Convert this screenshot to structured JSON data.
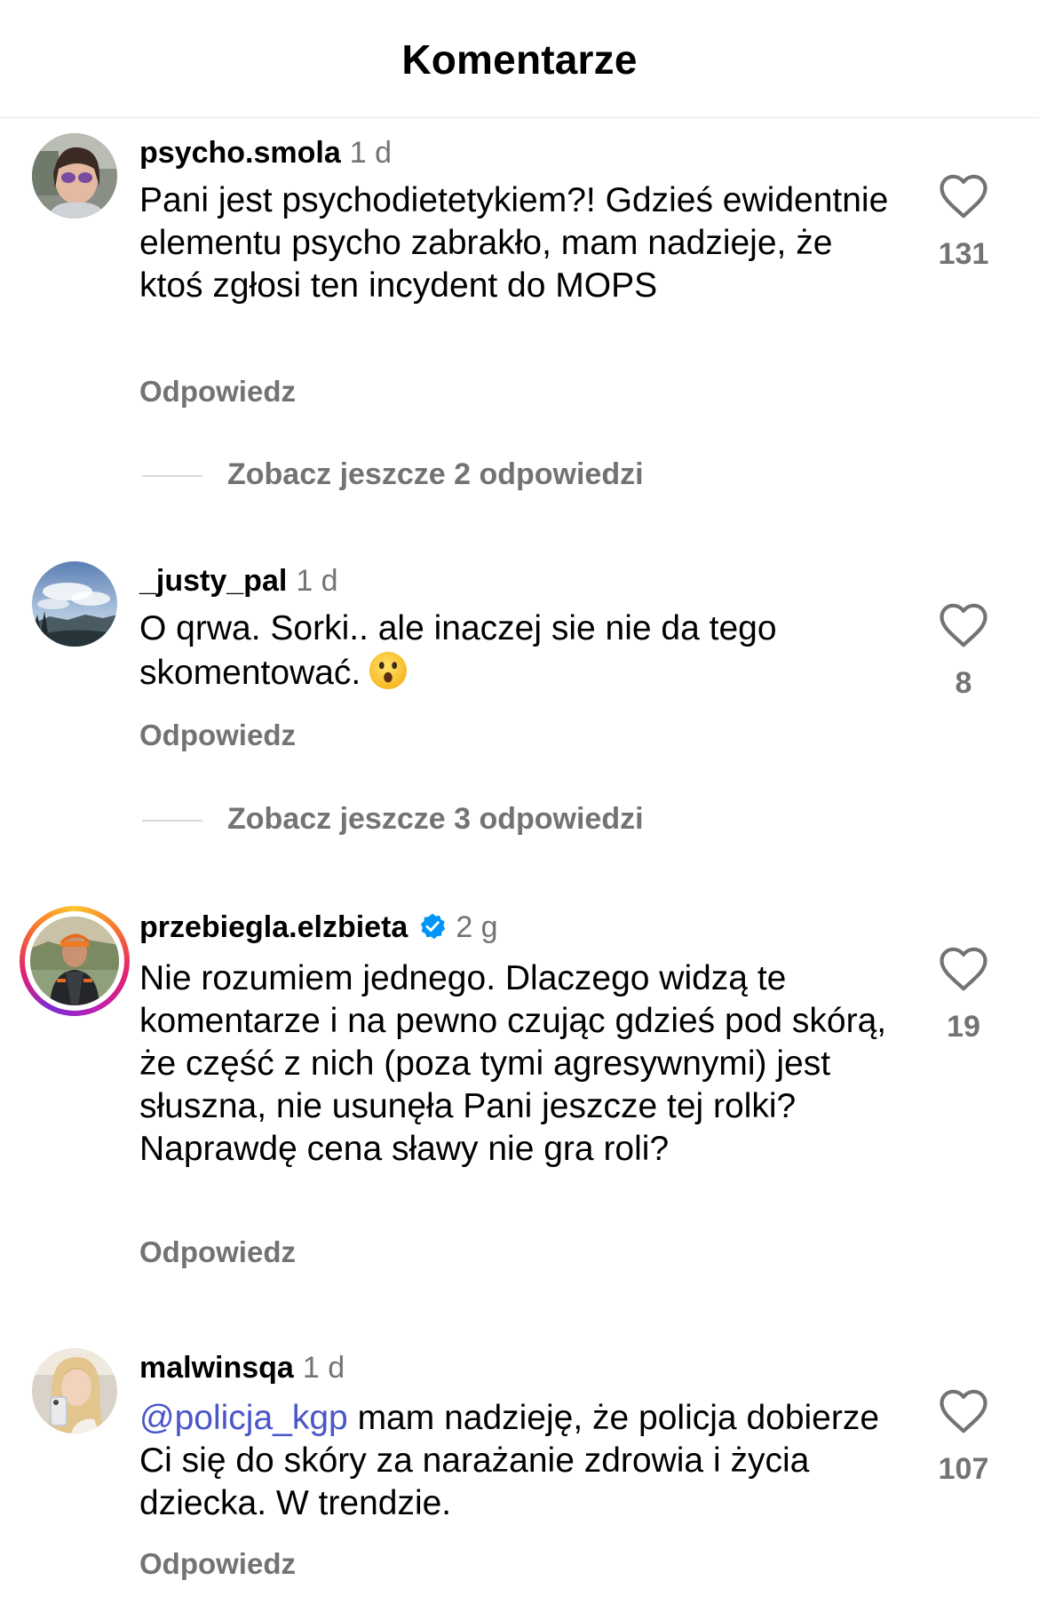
{
  "header": {
    "title": "Komentarze"
  },
  "comments": [
    {
      "username": "psycho.smola",
      "time": "1 d",
      "text": "Pani jest psychodietetykiem?! Gdzieś ewidentnie elementu psycho zabrakło, mam nadzieje, że ktoś zgłosi ten incydent do MOPS",
      "reply_label": "Odpowiedz",
      "likes": "131",
      "more_replies": "Zobacz jeszcze 2 odpowiedzi"
    },
    {
      "username": "_justy_pal",
      "time": "1 d",
      "text": "O qrwa. Sorki.. ale inaczej sie nie da tego skomentować.",
      "emoji": "hushed-face-emoji",
      "reply_label": "Odpowiedz",
      "likes": "8",
      "more_replies": "Zobacz jeszcze 3 odpowiedzi"
    },
    {
      "username": "przebiegla.elzbieta",
      "verified": true,
      "time": "2 g",
      "text": "Nie rozumiem jednego. Dlaczego widzą te komentarze i na pewno czując gdzieś pod skórą, że część z nich (poza tymi agresywnymi) jest słuszna, nie usunęła Pani jeszcze tej rolki? Naprawdę cena sławy nie gra roli?",
      "reply_label": "Odpowiedz",
      "likes": "19"
    },
    {
      "username": "malwinsqa",
      "time": "1 d",
      "mention": "@policja_kgp",
      "text": " mam nadzieję, że policja dobierze Ci się do skóry za narażanie zdrowia i życia dziecka. W trendzie.",
      "reply_label": "Odpowiedz",
      "likes": "107"
    }
  ],
  "colors": {
    "secondary_text": "#737373",
    "mention": "#4a56c9",
    "verified": "#0095f6",
    "divider": "#e6e6e6"
  }
}
